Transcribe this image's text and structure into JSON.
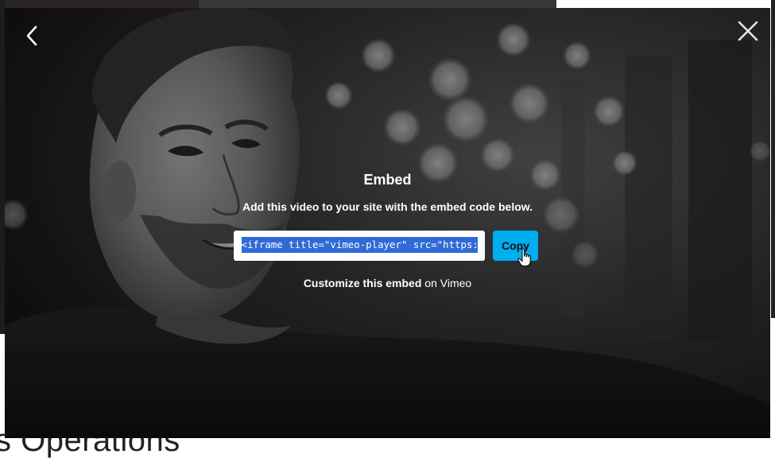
{
  "page": {
    "heading_fragment": "s Operations"
  },
  "navigation": {
    "back_icon": "chevron-left-icon",
    "close_icon": "close-icon"
  },
  "embed": {
    "title": "Embed",
    "subtitle": "Add this video to your site with the embed code below.",
    "code": "<iframe title=\"vimeo-player\" src=\"https:",
    "copy_label": "Copy",
    "customize_link": "Customize this embed",
    "customize_suffix": " on Vimeo"
  },
  "colors": {
    "copy_button": "#00adef",
    "selection": "#2f6bd6",
    "text": "#ffffff"
  }
}
